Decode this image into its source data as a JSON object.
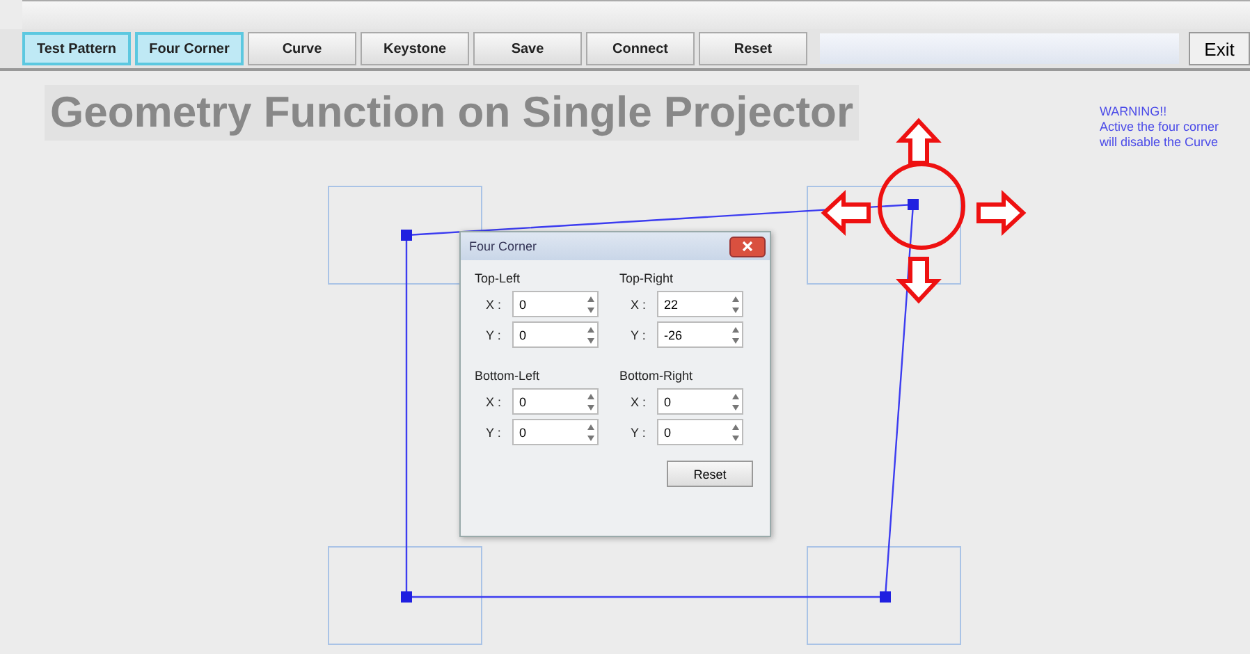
{
  "toolbar": {
    "buttons": [
      {
        "label": "Test Pattern",
        "selected": true
      },
      {
        "label": "Four Corner",
        "selected": true
      },
      {
        "label": "Curve",
        "selected": false
      },
      {
        "label": "Keystone",
        "selected": false
      },
      {
        "label": "Save",
        "selected": false
      },
      {
        "label": "Connect",
        "selected": false
      },
      {
        "label": "Reset",
        "selected": false
      }
    ],
    "exit": "Exit"
  },
  "heading": "Geometry Function on Single Projector",
  "warning": [
    "WARNING!!",
    "Active the four corner",
    "will disable the Curve"
  ],
  "dialog": {
    "title": "Four Corner",
    "corners": [
      {
        "label": "Top-Left",
        "fields": [
          {
            "label": "X :",
            "value": "0"
          },
          {
            "label": "Y :",
            "value": "0"
          }
        ]
      },
      {
        "label": "Top-Right",
        "fields": [
          {
            "label": "X :",
            "value": "22"
          },
          {
            "label": "Y :",
            "value": "-26"
          }
        ]
      },
      {
        "label": "Bottom-Left",
        "fields": [
          {
            "label": "X :",
            "value": "0"
          },
          {
            "label": "Y :",
            "value": "0"
          }
        ]
      },
      {
        "label": "Bottom-Right",
        "fields": [
          {
            "label": "X :",
            "value": "0"
          },
          {
            "label": "Y :",
            "value": "0"
          }
        ]
      }
    ],
    "reset": "Reset"
  }
}
